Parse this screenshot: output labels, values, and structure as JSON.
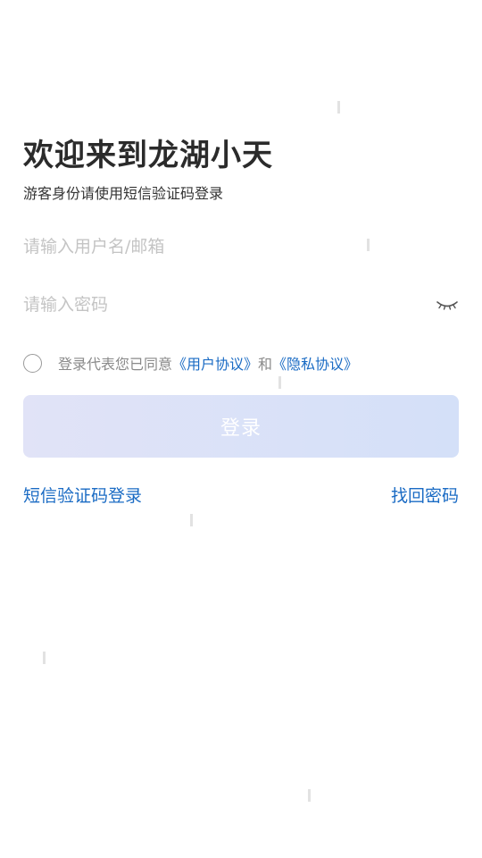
{
  "header": {
    "title": "欢迎来到龙湖小天",
    "subtitle": "游客身份请使用短信验证码登录"
  },
  "form": {
    "username_placeholder": "请输入用户名/邮箱",
    "username_value": "",
    "password_placeholder": "请输入密码",
    "password_value": ""
  },
  "agreement": {
    "prefix": "登录代表您已同意",
    "user_agreement": "《用户协议》",
    "conjunction": "和",
    "privacy_policy": "《隐私协议》",
    "checked": false
  },
  "actions": {
    "login_label": "登录",
    "sms_login": "短信验证码登录",
    "forgot_password": "找回密码"
  },
  "colors": {
    "link": "#1a6bc4",
    "button_gradient_start": "#e1e3f7",
    "button_gradient_end": "#d4e0f8",
    "placeholder": "#c4c4c4"
  },
  "icons": {
    "password_toggle": "eye-closed-icon"
  }
}
